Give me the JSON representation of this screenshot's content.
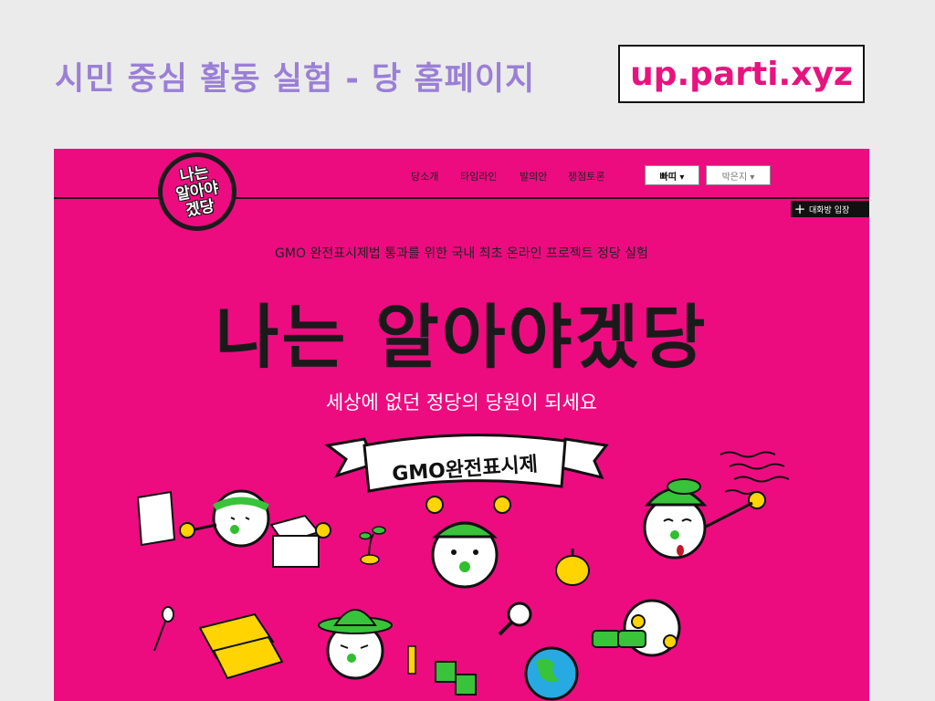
{
  "slide": {
    "title": "시민 중심 활동 실험 - 당 홈페이지",
    "url": "up.parti.xyz"
  },
  "site": {
    "logo_lines": [
      "나는",
      "알아야",
      "겠당"
    ],
    "nav": [
      "당소개",
      "타임라인",
      "발의안",
      "쟁점토론"
    ],
    "dropdown_1": "빠띠 ▾",
    "dropdown_2": "박은지 ▾",
    "chat_button": "대화방 입장",
    "subtitle": "GMO 완전표시제법 통과를 위한 국내 최초 온라인 프로젝트 정당 실험",
    "hero_title": "나는 알아야겠당",
    "tagline": "세상에 없던 정당의 당원이 되세요",
    "banner_text": "GMO완전표시제"
  },
  "colors": {
    "background": "#ebebeb",
    "site_bg": "#ec0c80",
    "title": "#9a7fd6",
    "url": "#e8137f"
  }
}
